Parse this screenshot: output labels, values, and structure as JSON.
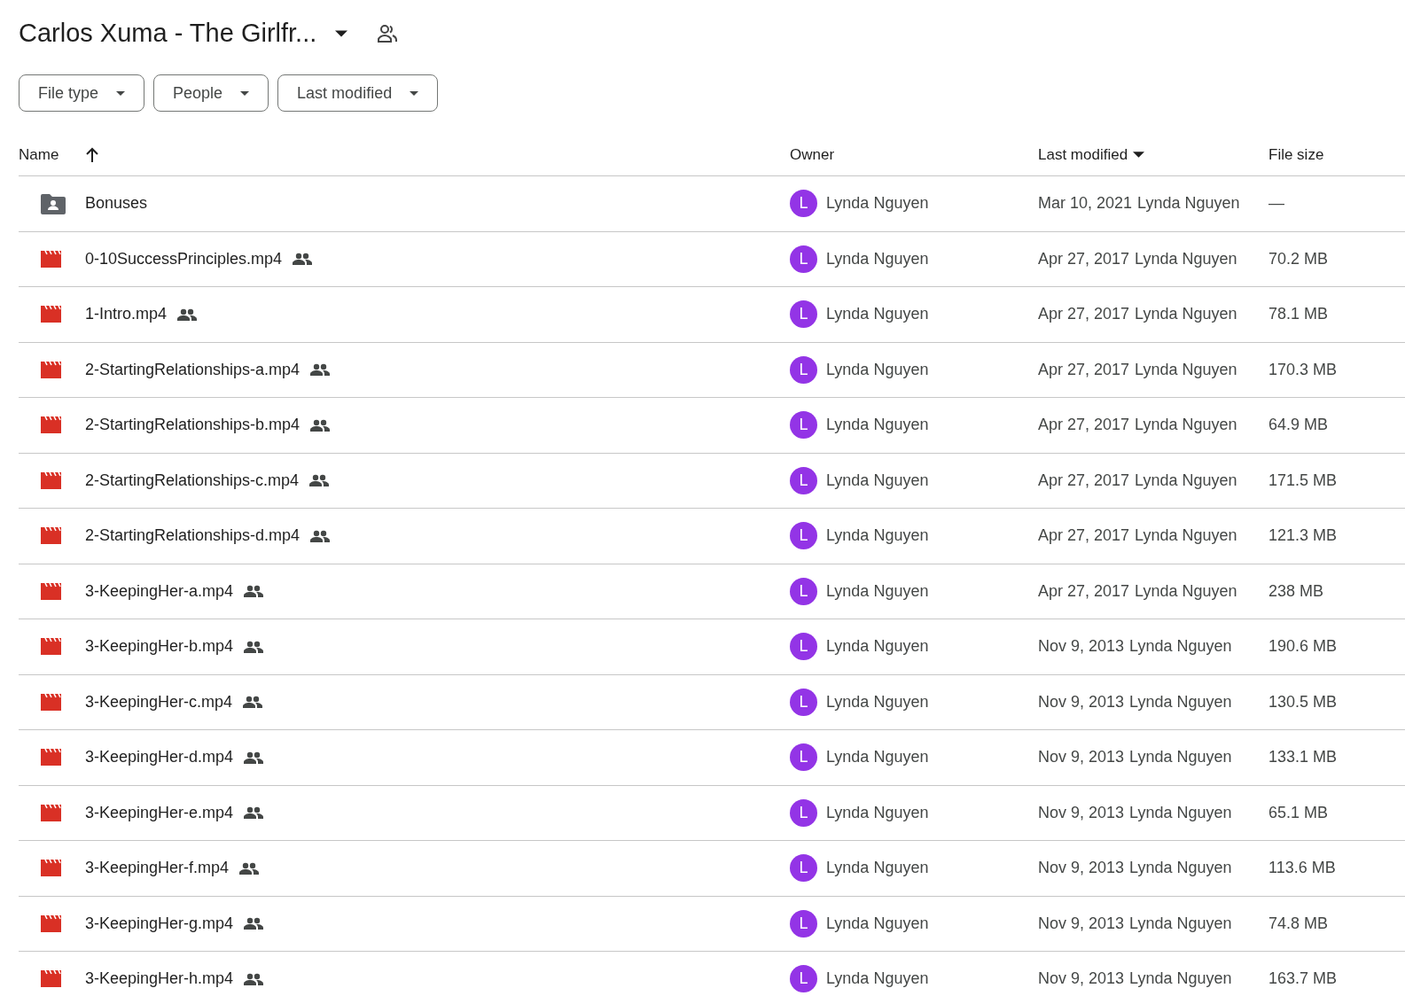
{
  "header": {
    "title": "Carlos Xuma - The Girlfr...",
    "shared": true
  },
  "filters": [
    "File type",
    "People",
    "Last modified"
  ],
  "table": {
    "columns": [
      {
        "label": "Name",
        "sorted_up": true,
        "sorted_down": false
      },
      {
        "label": "Owner",
        "sorted_up": false,
        "sorted_down": false
      },
      {
        "label": "Last modified",
        "sorted_up": false,
        "sorted_down": true
      },
      {
        "label": "File size",
        "sorted_up": false,
        "sorted_down": false
      }
    ],
    "rows": [
      {
        "kind": "folder",
        "name": "Bonuses",
        "shared": false,
        "owner_initial": "L",
        "owner": "Lynda Nguyen",
        "date": "Mar 10, 2021",
        "modified_by": "Lynda Nguyen",
        "size": "—"
      },
      {
        "kind": "video",
        "name": "0-10SuccessPrinciples.mp4",
        "shared": true,
        "owner_initial": "L",
        "owner": "Lynda Nguyen",
        "date": "Apr 27, 2017",
        "modified_by": "Lynda Nguyen",
        "size": "70.2 MB"
      },
      {
        "kind": "video",
        "name": "1-Intro.mp4",
        "shared": true,
        "owner_initial": "L",
        "owner": "Lynda Nguyen",
        "date": "Apr 27, 2017",
        "modified_by": "Lynda Nguyen",
        "size": "78.1 MB"
      },
      {
        "kind": "video",
        "name": "2-StartingRelationships-a.mp4",
        "shared": true,
        "owner_initial": "L",
        "owner": "Lynda Nguyen",
        "date": "Apr 27, 2017",
        "modified_by": "Lynda Nguyen",
        "size": "170.3 MB"
      },
      {
        "kind": "video",
        "name": "2-StartingRelationships-b.mp4",
        "shared": true,
        "owner_initial": "L",
        "owner": "Lynda Nguyen",
        "date": "Apr 27, 2017",
        "modified_by": "Lynda Nguyen",
        "size": "64.9 MB"
      },
      {
        "kind": "video",
        "name": "2-StartingRelationships-c.mp4",
        "shared": true,
        "owner_initial": "L",
        "owner": "Lynda Nguyen",
        "date": "Apr 27, 2017",
        "modified_by": "Lynda Nguyen",
        "size": "171.5 MB"
      },
      {
        "kind": "video",
        "name": "2-StartingRelationships-d.mp4",
        "shared": true,
        "owner_initial": "L",
        "owner": "Lynda Nguyen",
        "date": "Apr 27, 2017",
        "modified_by": "Lynda Nguyen",
        "size": "121.3 MB"
      },
      {
        "kind": "video",
        "name": "3-KeepingHer-a.mp4",
        "shared": true,
        "owner_initial": "L",
        "owner": "Lynda Nguyen",
        "date": "Apr 27, 2017",
        "modified_by": "Lynda Nguyen",
        "size": "238 MB"
      },
      {
        "kind": "video",
        "name": "3-KeepingHer-b.mp4",
        "shared": true,
        "owner_initial": "L",
        "owner": "Lynda Nguyen",
        "date": "Nov 9, 2013",
        "modified_by": "Lynda Nguyen",
        "size": "190.6 MB"
      },
      {
        "kind": "video",
        "name": "3-KeepingHer-c.mp4",
        "shared": true,
        "owner_initial": "L",
        "owner": "Lynda Nguyen",
        "date": "Nov 9, 2013",
        "modified_by": "Lynda Nguyen",
        "size": "130.5 MB"
      },
      {
        "kind": "video",
        "name": "3-KeepingHer-d.mp4",
        "shared": true,
        "owner_initial": "L",
        "owner": "Lynda Nguyen",
        "date": "Nov 9, 2013",
        "modified_by": "Lynda Nguyen",
        "size": "133.1 MB"
      },
      {
        "kind": "video",
        "name": "3-KeepingHer-e.mp4",
        "shared": true,
        "owner_initial": "L",
        "owner": "Lynda Nguyen",
        "date": "Nov 9, 2013",
        "modified_by": "Lynda Nguyen",
        "size": "65.1 MB"
      },
      {
        "kind": "video",
        "name": "3-KeepingHer-f.mp4",
        "shared": true,
        "owner_initial": "L",
        "owner": "Lynda Nguyen",
        "date": "Nov 9, 2013",
        "modified_by": "Lynda Nguyen",
        "size": "113.6 MB"
      },
      {
        "kind": "video",
        "name": "3-KeepingHer-g.mp4",
        "shared": true,
        "owner_initial": "L",
        "owner": "Lynda Nguyen",
        "date": "Nov 9, 2013",
        "modified_by": "Lynda Nguyen",
        "size": "74.8 MB"
      },
      {
        "kind": "video",
        "name": "3-KeepingHer-h.mp4",
        "shared": true,
        "owner_initial": "L",
        "owner": "Lynda Nguyen",
        "date": "Nov 9, 2013",
        "modified_by": "Lynda Nguyen",
        "size": "163.7 MB"
      }
    ]
  }
}
